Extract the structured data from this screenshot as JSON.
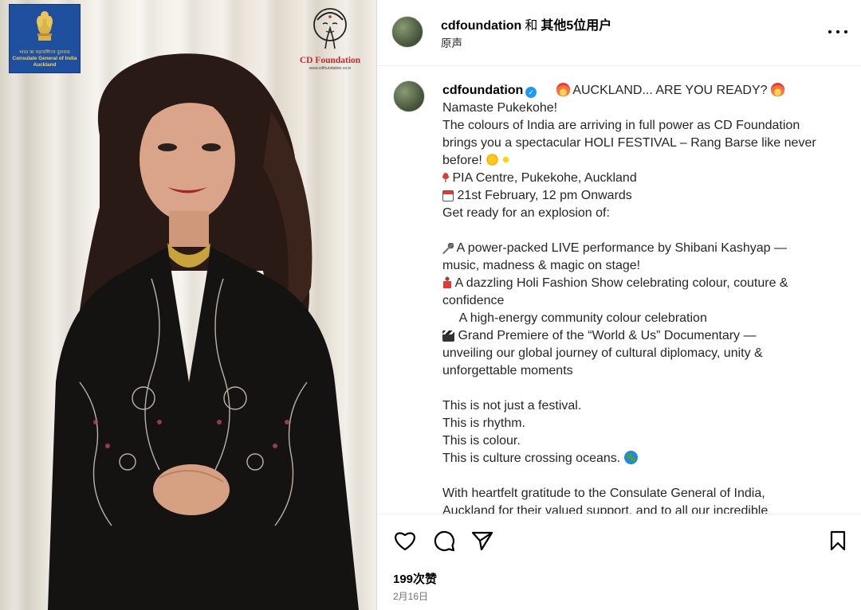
{
  "media": {
    "badge": {
      "hindi_text": "भारत का महावाणिज्य दूतावास",
      "line1": "Consulate General of India",
      "line2": "Auckland"
    },
    "logo": {
      "name": "CD Foundation",
      "url": "www.cdfoundation.co.in"
    }
  },
  "header": {
    "username": "cdfoundation",
    "separator": "和",
    "others": "其他5位用户",
    "audio_label": "原声"
  },
  "caption": {
    "username": "cdfoundation",
    "lines": [
      "AUCKLAND... ARE YOU READY?",
      "Namaste Pukekohe!",
      "The colours of India are arriving in full power as CD Foundation",
      "brings you a spectacular HOLI FESTIVAL – Rang Barse like never",
      "before!",
      "PIA Centre, Pukekohe, Auckland",
      "21st February, 12 pm Onwards",
      "Get ready for an explosion of:",
      "",
      "A power-packed LIVE performance by Shibani Kashyap —",
      "music, madness & magic on stage!",
      "A dazzling Holi Fashion Show celebrating colour, couture &",
      "confidence",
      "A high-energy community colour celebration",
      "Grand Premiere of the “World & Us” Documentary —",
      "unveiling our global journey of cultural diplomacy, unity &",
      "unforgettable moments",
      "",
      "This is not just a festival.",
      "This is rhythm.",
      "This is colour.",
      "This is culture crossing oceans.",
      "",
      "With heartfelt gratitude to the Consulate General of India,",
      "Auckland for their valued support, and to all our incredible"
    ]
  },
  "actions": {
    "like_icon": "heart-icon",
    "comment_icon": "comment-icon",
    "share_icon": "send-icon",
    "save_icon": "bookmark-icon",
    "likes": "199次赞",
    "date": "2月16日"
  }
}
